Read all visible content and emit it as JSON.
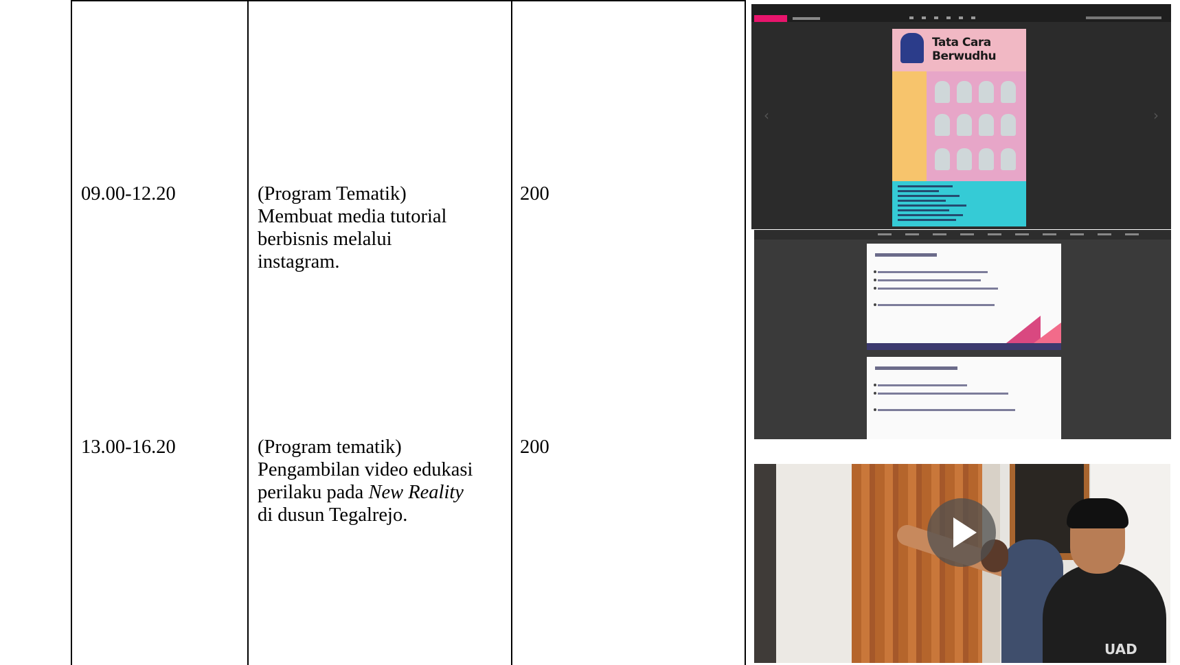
{
  "table": {
    "rows": [
      {
        "time": "09.00-12.20",
        "activity_lines": "(Program Tematik)\nMembuat media tutorial\nberbisnis melalui\ninstagram.",
        "minutes": "200"
      },
      {
        "time": "13.00-16.20",
        "activity_line1": "(Program tematik)",
        "activity_line2": "Pengambilan video edukasi",
        "activity_line3_prefix": "perilaku pada ",
        "activity_line3_italic": "New Reality",
        "activity_line4": "di dusun Tegalrejo.",
        "minutes": "200"
      }
    ]
  },
  "documentation": {
    "poster_title": "Tata Cara Berwudhu",
    "video_shirt_logo": "UAD",
    "video_play_icon": "play-icon"
  }
}
